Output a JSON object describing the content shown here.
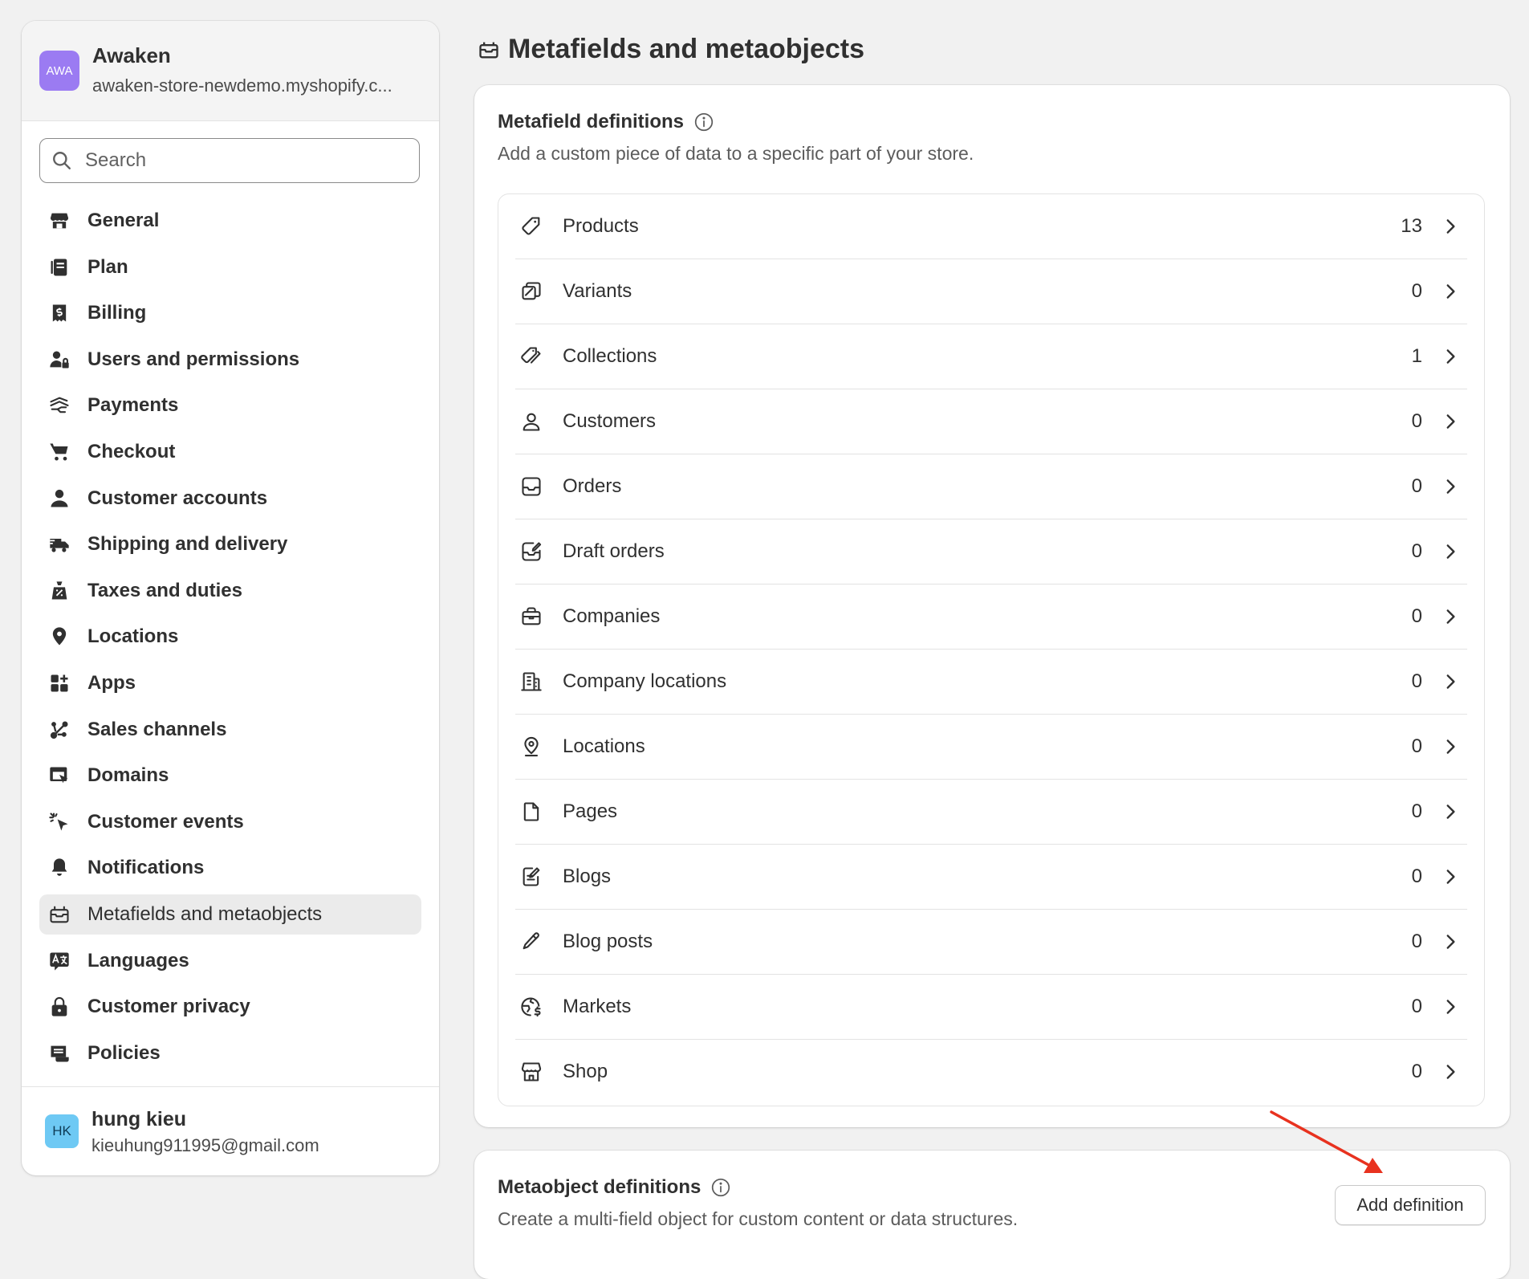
{
  "store": {
    "avatar_text": "AWA",
    "name": "Awaken",
    "domain": "awaken-store-newdemo.myshopify.c..."
  },
  "search": {
    "placeholder": "Search"
  },
  "nav": [
    {
      "label": "General",
      "icon": "store-icon"
    },
    {
      "label": "Plan",
      "icon": "plan-icon"
    },
    {
      "label": "Billing",
      "icon": "receipt-dollar-icon"
    },
    {
      "label": "Users and permissions",
      "icon": "users-lock-icon"
    },
    {
      "label": "Payments",
      "icon": "payment-hand-icon"
    },
    {
      "label": "Checkout",
      "icon": "cart-icon"
    },
    {
      "label": "Customer accounts",
      "icon": "person-icon"
    },
    {
      "label": "Shipping and delivery",
      "icon": "truck-icon"
    },
    {
      "label": "Taxes and duties",
      "icon": "tax-bag-icon"
    },
    {
      "label": "Locations",
      "icon": "location-pin-icon"
    },
    {
      "label": "Apps",
      "icon": "apps-icon"
    },
    {
      "label": "Sales channels",
      "icon": "channels-icon"
    },
    {
      "label": "Domains",
      "icon": "domain-icon"
    },
    {
      "label": "Customer events",
      "icon": "cursor-click-icon"
    },
    {
      "label": "Notifications",
      "icon": "bell-icon"
    },
    {
      "label": "Metafields and metaobjects",
      "icon": "metafield-icon",
      "active": true
    },
    {
      "label": "Languages",
      "icon": "language-icon"
    },
    {
      "label": "Customer privacy",
      "icon": "lock-icon"
    },
    {
      "label": "Policies",
      "icon": "policy-icon"
    }
  ],
  "user": {
    "initials": "HK",
    "name": "hung kieu",
    "email": "kieuhung911995@gmail.com"
  },
  "page": {
    "title": "Metafields and metaobjects"
  },
  "metafields": {
    "title": "Metafield definitions",
    "subtitle": "Add a custom piece of data to a specific part of your store.",
    "rows": [
      {
        "label": "Products",
        "count": "13",
        "icon": "product-tag-icon"
      },
      {
        "label": "Variants",
        "count": "0",
        "icon": "variant-icon"
      },
      {
        "label": "Collections",
        "count": "1",
        "icon": "collection-tags-icon"
      },
      {
        "label": "Customers",
        "count": "0",
        "icon": "customer-icon"
      },
      {
        "label": "Orders",
        "count": "0",
        "icon": "order-inbox-icon"
      },
      {
        "label": "Draft orders",
        "count": "0",
        "icon": "draft-order-icon"
      },
      {
        "label": "Companies",
        "count": "0",
        "icon": "briefcase-icon"
      },
      {
        "label": "Company locations",
        "count": "0",
        "icon": "building-icon"
      },
      {
        "label": "Locations",
        "count": "0",
        "icon": "location-icon"
      },
      {
        "label": "Pages",
        "count": "0",
        "icon": "page-icon"
      },
      {
        "label": "Blogs",
        "count": "0",
        "icon": "blog-icon"
      },
      {
        "label": "Blog posts",
        "count": "0",
        "icon": "pencil-icon"
      },
      {
        "label": "Markets",
        "count": "0",
        "icon": "globe-dollar-icon"
      },
      {
        "label": "Shop",
        "count": "0",
        "icon": "shop-icon"
      }
    ]
  },
  "metaobjects": {
    "title": "Metaobject definitions",
    "subtitle": "Create a multi-field object for custom content or data structures.",
    "add_button": "Add definition"
  },
  "colors": {
    "accent_arrow": "#e8321f",
    "store_avatar": "#9b7bf2",
    "user_avatar": "#6ec9f4"
  }
}
